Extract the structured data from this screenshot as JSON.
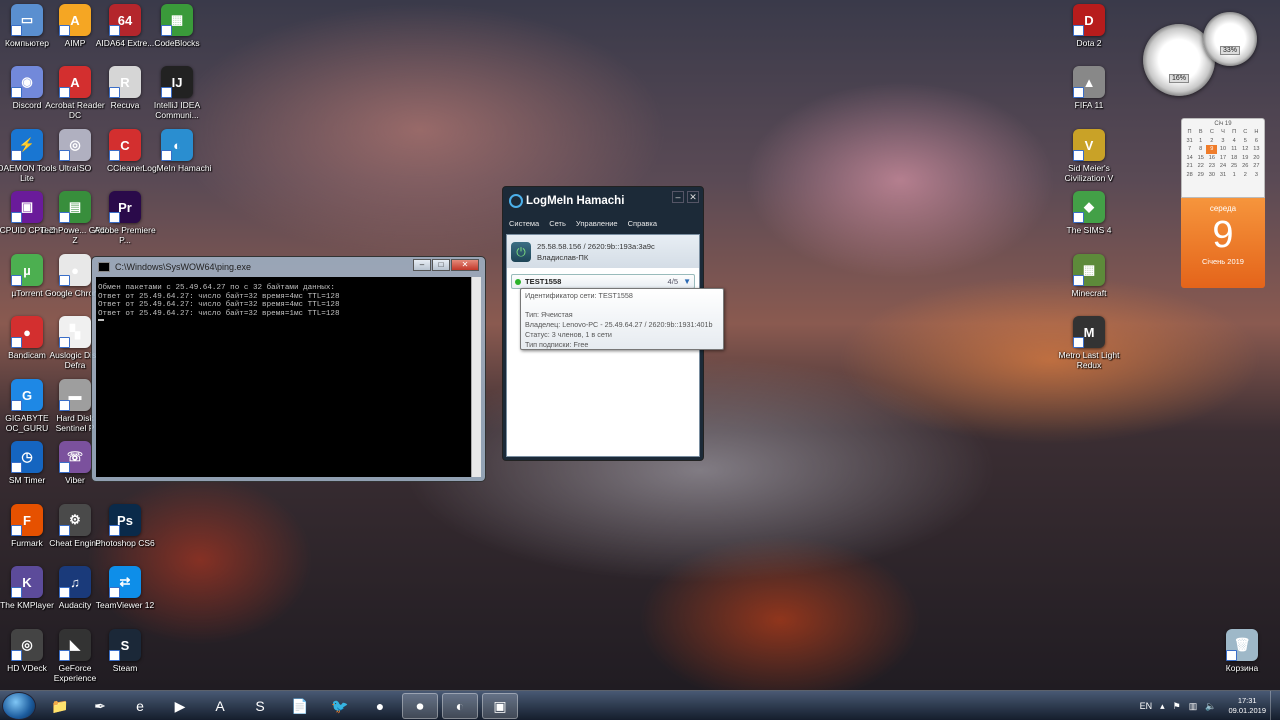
{
  "desktop_icons": [
    {
      "label": "Компьютер",
      "color": "#5a8fd0",
      "glyph": "▭"
    },
    {
      "label": "AIMP",
      "color": "#f5a623",
      "glyph": "A"
    },
    {
      "label": "AIDA64 Extre...",
      "color": "#b4262c",
      "glyph": "64"
    },
    {
      "label": "CodeBlocks",
      "color": "#3a9a3a",
      "glyph": "▦"
    },
    {
      "label": "Discord",
      "color": "#7289da",
      "glyph": "◉"
    },
    {
      "label": "Acrobat Reader DC",
      "color": "#d32f2f",
      "glyph": "A"
    },
    {
      "label": "Recuva",
      "color": "#d6d6d6",
      "glyph": "R"
    },
    {
      "label": "IntelliJ IDEA Communi...",
      "color": "#222222",
      "glyph": "IJ"
    },
    {
      "label": "DAEMON Tools Lite",
      "color": "#1976d2",
      "glyph": "⚡"
    },
    {
      "label": "UltraISO",
      "color": "#b0b0c0",
      "glyph": "◎"
    },
    {
      "label": "CCleaner",
      "color": "#d32f2f",
      "glyph": "C"
    },
    {
      "label": "LogMeIn Hamachi",
      "color": "#2a8ed0",
      "glyph": "◐"
    },
    {
      "label": "CPUID CPU-Z",
      "color": "#6a1b9a",
      "glyph": "▣"
    },
    {
      "label": "TechPowe... GPU-Z",
      "color": "#388e3c",
      "glyph": "▤"
    },
    {
      "label": "Adobe Premiere P...",
      "color": "#2a0a4a",
      "glyph": "Pr"
    },
    {
      "label": "µTorrent",
      "color": "#4caf50",
      "glyph": "µ"
    },
    {
      "label": "Google Chrome",
      "color": "#e8e8e8",
      "glyph": "●"
    },
    {
      "label": "Bandicam",
      "color": "#d32f2f",
      "glyph": "●"
    },
    {
      "label": "Auslogic Disk Defra",
      "color": "#f0f0f0",
      "glyph": "▚"
    },
    {
      "label": "GIGABYTE OC_GURU",
      "color": "#1e88e5",
      "glyph": "G"
    },
    {
      "label": "Hard Disk Sentinel P",
      "color": "#9e9e9e",
      "glyph": "▬"
    },
    {
      "label": "SM Timer",
      "color": "#1565c0",
      "glyph": "◷"
    },
    {
      "label": "Viber",
      "color": "#7b519d",
      "glyph": "☏"
    },
    {
      "label": "Furmark",
      "color": "#e65100",
      "glyph": "F"
    },
    {
      "label": "Cheat Engine",
      "color": "#4a4a4a",
      "glyph": "⚙"
    },
    {
      "label": "Photoshop CS6",
      "color": "#0a2a4a",
      "glyph": "Ps"
    },
    {
      "label": "The KMPlayer",
      "color": "#5c4b9a",
      "glyph": "K"
    },
    {
      "label": "Audacity",
      "color": "#1a3a7a",
      "glyph": "♫"
    },
    {
      "label": "TeamViewer 12",
      "color": "#0e8ee9",
      "glyph": "⇄"
    },
    {
      "label": "HD VDeck",
      "color": "#444444",
      "glyph": "◎"
    },
    {
      "label": "GeForce Experience",
      "color": "#333333",
      "glyph": "◣"
    },
    {
      "label": "Steam",
      "color": "#1b2838",
      "glyph": "S"
    }
  ],
  "right_icons": [
    {
      "label": "Dota 2",
      "color": "#b71c1c",
      "glyph": "D"
    },
    {
      "label": "FIFA 11",
      "color": "#888888",
      "glyph": "▲"
    },
    {
      "label": "Sid Meier's Civilization V",
      "color": "#c9a227",
      "glyph": "V"
    },
    {
      "label": "The SIMS 4",
      "color": "#43a047",
      "glyph": "◆"
    },
    {
      "label": "Minecraft",
      "color": "#5d8a3a",
      "glyph": "▦"
    },
    {
      "label": "Metro Last Light Redux",
      "color": "#333333",
      "glyph": "M"
    },
    {
      "label": "Корзина",
      "color": "#9eb8c8",
      "glyph": "🗑"
    }
  ],
  "cmd": {
    "title": "C:\\Windows\\SysWOW64\\ping.exe",
    "lines": [
      "Обмен пакетами с 25.49.64.27 по с 32 байтами данных:",
      "Ответ от 25.49.64.27: число байт=32 время=4мс TTL=128",
      "Ответ от 25.49.64.27: число байт=32 время=4мс TTL=128",
      "Ответ от 25.49.64.27: число байт=32 время=1мс TTL=128"
    ]
  },
  "hamachi": {
    "title": "LogMeIn Hamachi",
    "menu": [
      "Система",
      "Сеть",
      "Управление",
      "Справка"
    ],
    "ip": "25.58.58.156 / 2620:9b::193a:3a9c",
    "pc_name": "Владислав-ПК",
    "network": {
      "name": "TEST1558",
      "count": "4/5"
    },
    "tooltip": [
      "Идентификатор сети: TEST1558",
      "",
      "Тип: Ячеистая",
      "Владелец: Lenovo-PC - 25.49.64.27 / 2620:9b::1931:401b",
      "Статус: 3 членов, 1 в сети",
      "Тип подписки: Free"
    ]
  },
  "gauges": {
    "cpu": "16%",
    "ram": "33%"
  },
  "calendar": {
    "month_short": "Січ 19",
    "weekdays": [
      "П",
      "В",
      "С",
      "Ч",
      "П",
      "С",
      "Н"
    ],
    "days": [
      "31",
      "1",
      "2",
      "3",
      "4",
      "5",
      "6",
      "7",
      "8",
      "9",
      "10",
      "11",
      "12",
      "13",
      "14",
      "15",
      "16",
      "17",
      "18",
      "19",
      "20",
      "21",
      "22",
      "23",
      "24",
      "25",
      "26",
      "27",
      "28",
      "29",
      "30",
      "31",
      "1",
      "2",
      "3"
    ],
    "today_index": 9,
    "day_of_week": "середа",
    "day": "9",
    "month_year": "Січень 2019"
  },
  "taskbar": {
    "items": [
      "📁",
      "✒",
      "e",
      "▶",
      "A",
      "S",
      "📄",
      "🐦",
      "●",
      "⏺",
      "◐",
      "▣"
    ],
    "active_indices": [
      9,
      10,
      11
    ],
    "lang": "EN",
    "time": "17:31",
    "date": "09.01.2019"
  }
}
